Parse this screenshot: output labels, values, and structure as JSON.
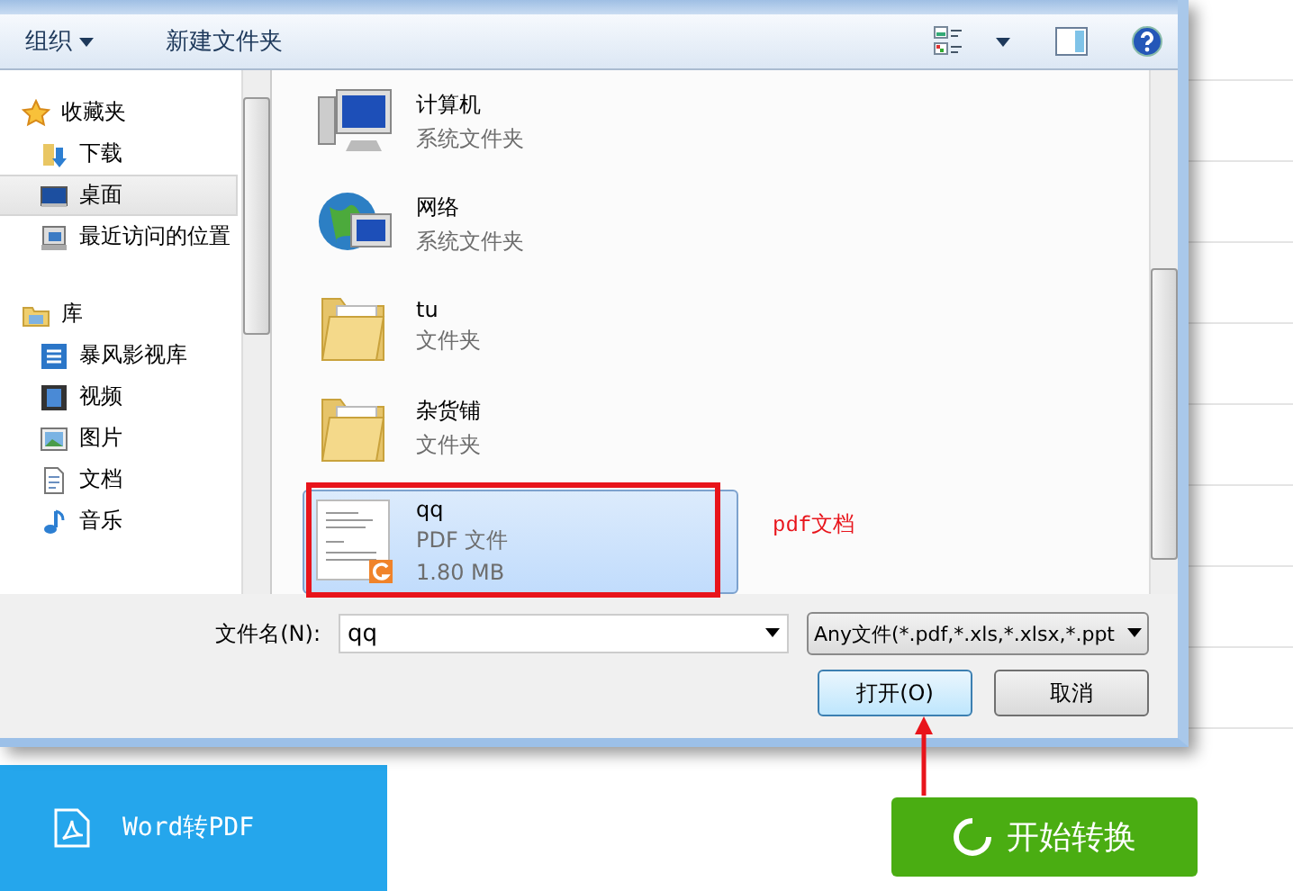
{
  "toolbar": {
    "organize": "组织",
    "new_folder": "新建文件夹"
  },
  "nav": [
    {
      "label": "收藏夹",
      "items": [
        {
          "label": "下载",
          "selected": false
        },
        {
          "label": "桌面",
          "selected": true
        },
        {
          "label": "最近访问的位置",
          "selected": false
        }
      ]
    },
    {
      "label": "库",
      "items": [
        {
          "label": "暴风影视库",
          "selected": false
        },
        {
          "label": "视频",
          "selected": false
        },
        {
          "label": "图片",
          "selected": false
        },
        {
          "label": "文档",
          "selected": false
        },
        {
          "label": "音乐",
          "selected": false
        }
      ]
    }
  ],
  "files": [
    {
      "name": "计算机",
      "type": "系统文件夹",
      "selected": false
    },
    {
      "name": "网络",
      "type": "系统文件夹",
      "selected": false
    },
    {
      "name": "tu",
      "type": "文件夹",
      "selected": false
    },
    {
      "name": "杂货铺",
      "type": "文件夹",
      "selected": false
    },
    {
      "name": "qq",
      "type": "PDF 文件",
      "size": "1.80 MB",
      "selected": true
    }
  ],
  "annotation": {
    "label": "pdf文档"
  },
  "filename": {
    "label": "文件名(N):",
    "value": "qq"
  },
  "filter": "Any文件(*.pdf,*.xls,*.xlsx,*.ppt",
  "buttons": {
    "open": "打开(O)",
    "cancel": "取消"
  },
  "app": {
    "sidebar_item": "Word转PDF",
    "start_button": "开始转换"
  }
}
